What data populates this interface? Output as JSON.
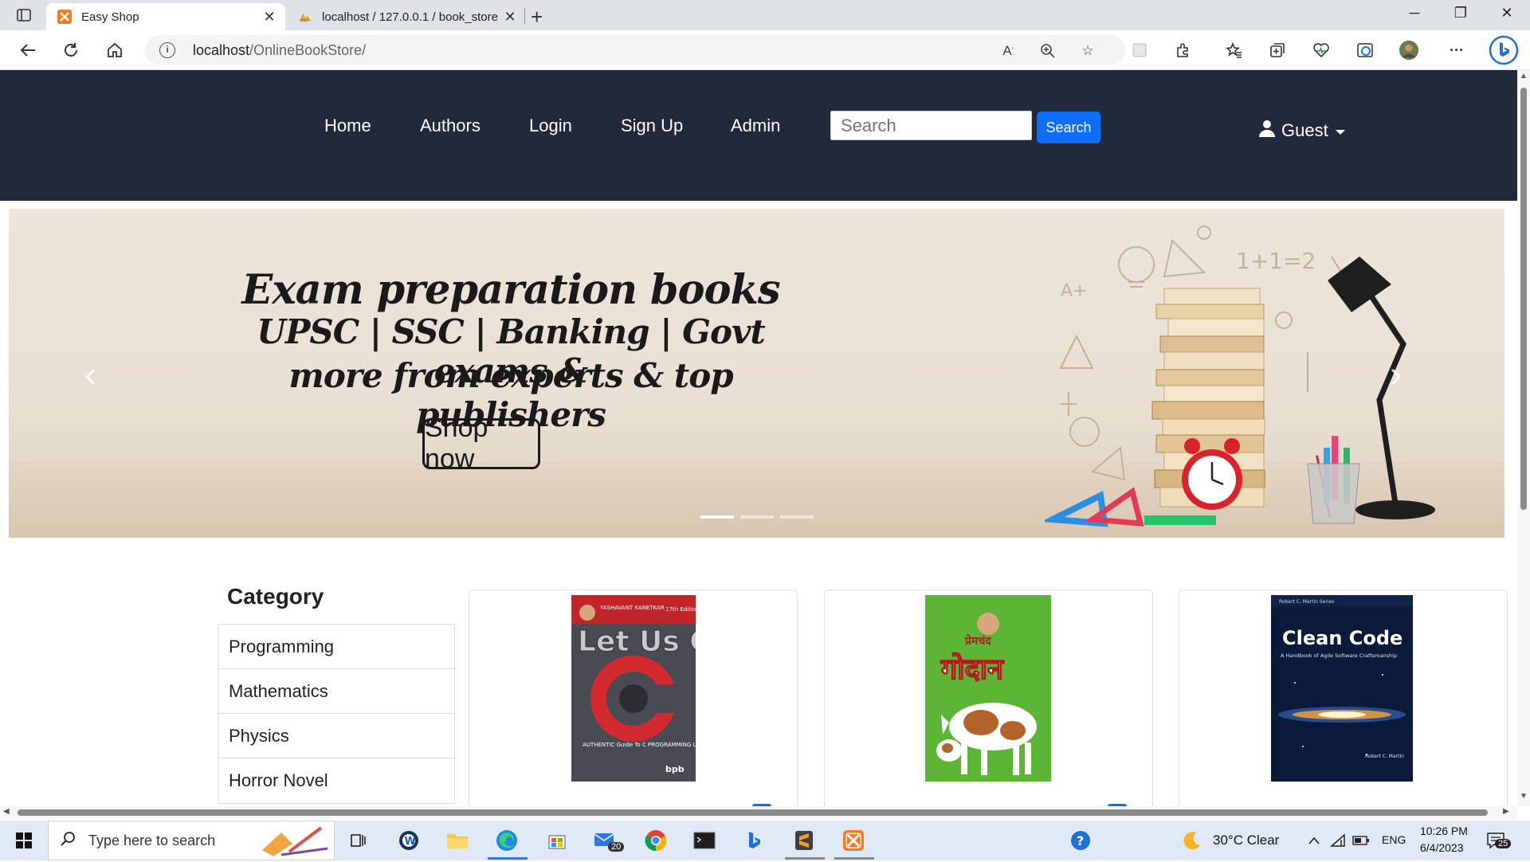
{
  "browser": {
    "tabs": [
      {
        "title": "Easy Shop",
        "active": true
      },
      {
        "title": "localhost / 127.0.0.1 / book_store",
        "active": false
      }
    ],
    "url_host": "localhost",
    "url_path": "/OnlineBookStore/"
  },
  "navbar": {
    "links": [
      "Home",
      "Authors",
      "Login",
      "Sign Up",
      "Admin"
    ],
    "search_placeholder": "Search",
    "search_button": "Search",
    "user_label": "Guest"
  },
  "carousel": {
    "headline": "Exam preparation books",
    "line2": "UPSC | SSC | Banking | Govt exams &",
    "line3": "more from experts & top publishers",
    "cta": "Shop now",
    "slide_count": 3,
    "active_slide": 1
  },
  "sidebar": {
    "title": "Category",
    "items": [
      "Programming",
      "Mathematics",
      "Physics",
      "Horror Novel"
    ]
  },
  "books": [
    {
      "cover_author": "YASHAVANT KANETKAR",
      "cover_title": "Let Us C",
      "cover_subtitle": "AUTHENTIC Guide To C PROGRAMMING Language",
      "cover_edition": "17th Edition",
      "cover_publisher": "bpb"
    },
    {
      "cover_author": "प्रेमचंद",
      "cover_title": "गोदान"
    },
    {
      "cover_author": "Robert C. Martin Series",
      "cover_title": "Clean Code",
      "cover_subtitle": "A Handbook of Agile Software Craftsmanship",
      "cover_footer": "Robert C. Martin"
    }
  ],
  "taskbar": {
    "search_placeholder": "Type here to search",
    "mail_badge": "20",
    "weather": "30°C  Clear",
    "language": "ENG",
    "time": "10:26 PM",
    "date": "6/4/2023",
    "notification_badge": "25"
  },
  "colors": {
    "navbar_bg": "#212a3a",
    "primary": "#0d6efd",
    "taskbar_bg": "#dfe9f5"
  }
}
